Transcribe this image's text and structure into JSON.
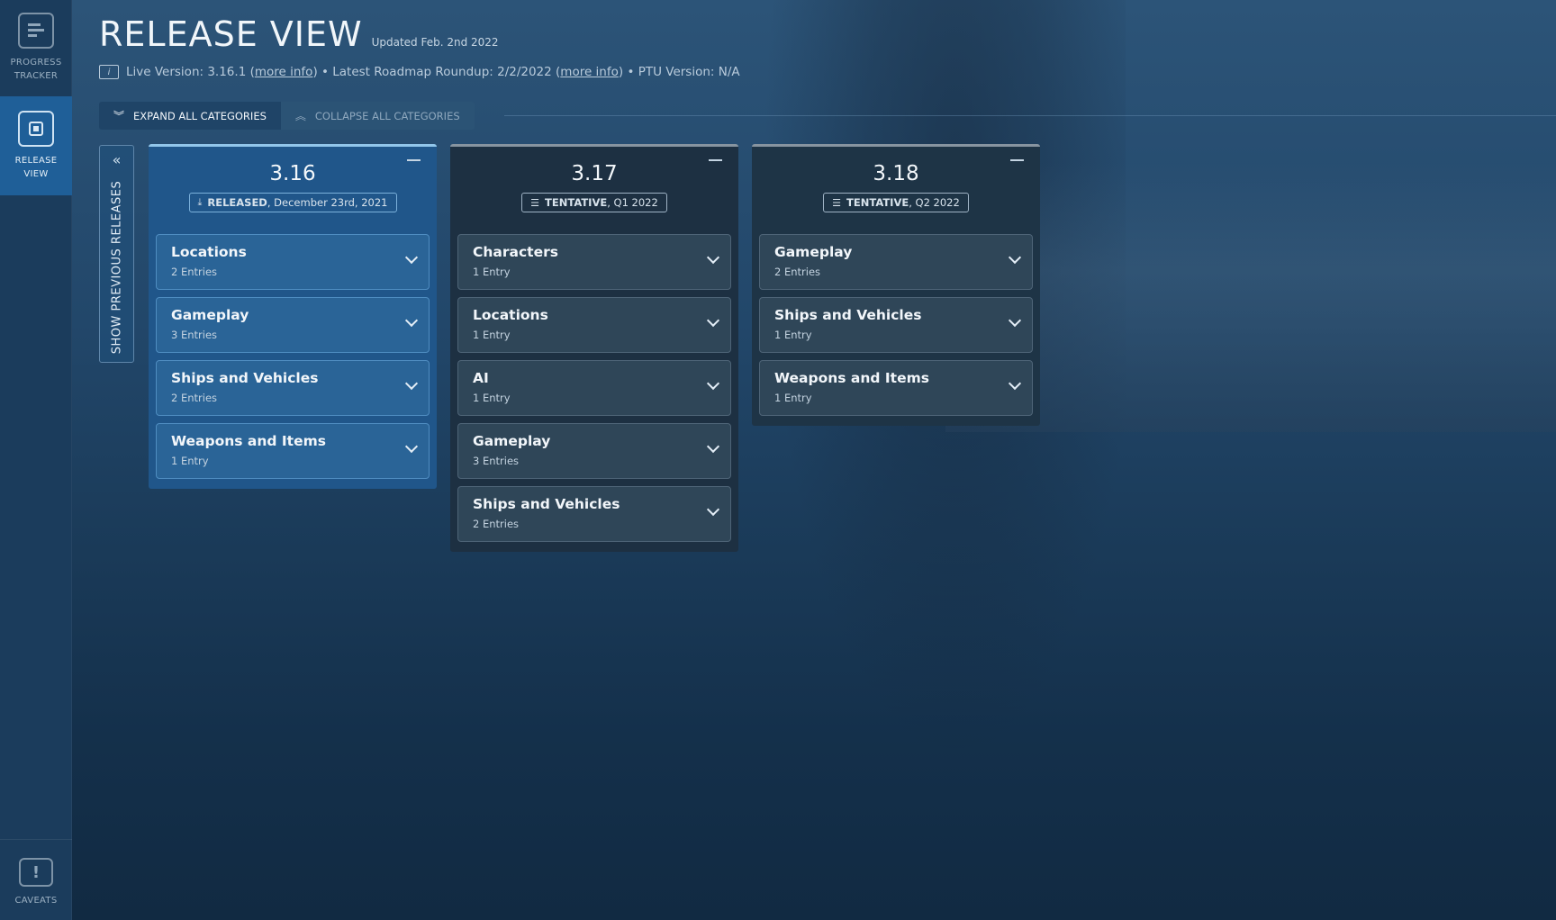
{
  "sidebar": {
    "progress_tracker": "PROGRESS\nTRACKER",
    "release_view": "RELEASE\nVIEW",
    "caveats": "CAVEATS",
    "icons": [
      "progress-tracker-icon",
      "release-view-icon",
      "caveats-icon"
    ]
  },
  "header": {
    "title": "RELEASE VIEW",
    "updated": "Updated Feb. 2nd 2022",
    "live_version": "Live Version: 3.16.1 (",
    "more_info_1": "more info",
    "after_1": ") • Latest Roadmap Roundup: 2/2/2022 (",
    "more_info_2": "more info",
    "after_2": ") • PTU Version: N/A"
  },
  "controls": {
    "expand_all": "EXPAND ALL CATEGORIES",
    "collapse_all": "COLLAPSE ALL CATEGORIES",
    "show_previous": "SHOW PREVIOUS RELEASES"
  },
  "releases": [
    {
      "version": "3.16",
      "status": "RELEASED",
      "date": ", December 23rd, 2021",
      "categories": [
        {
          "name": "Locations",
          "count": "2 Entries"
        },
        {
          "name": "Gameplay",
          "count": "3 Entries"
        },
        {
          "name": "Ships and Vehicles",
          "count": "2 Entries"
        },
        {
          "name": "Weapons and Items",
          "count": "1 Entry"
        }
      ]
    },
    {
      "version": "3.17",
      "status": "TENTATIVE",
      "date": ", Q1 2022",
      "categories": [
        {
          "name": "Characters",
          "count": "1 Entry"
        },
        {
          "name": "Locations",
          "count": "1 Entry"
        },
        {
          "name": "AI",
          "count": "1 Entry"
        },
        {
          "name": "Gameplay",
          "count": "3 Entries"
        },
        {
          "name": "Ships and Vehicles",
          "count": "2 Entries"
        }
      ]
    },
    {
      "version": "3.18",
      "status": "TENTATIVE",
      "date": ", Q2 2022",
      "categories": [
        {
          "name": "Gameplay",
          "count": "2 Entries"
        },
        {
          "name": "Ships and Vehicles",
          "count": "1 Entry"
        },
        {
          "name": "Weapons and Items",
          "count": "1 Entry"
        }
      ]
    }
  ],
  "colors": {
    "sidebar_bg": "#1b3c5c",
    "active_nav": "#1f5f98",
    "released_column": "#20568a",
    "tentative_column": "#1d3042"
  }
}
